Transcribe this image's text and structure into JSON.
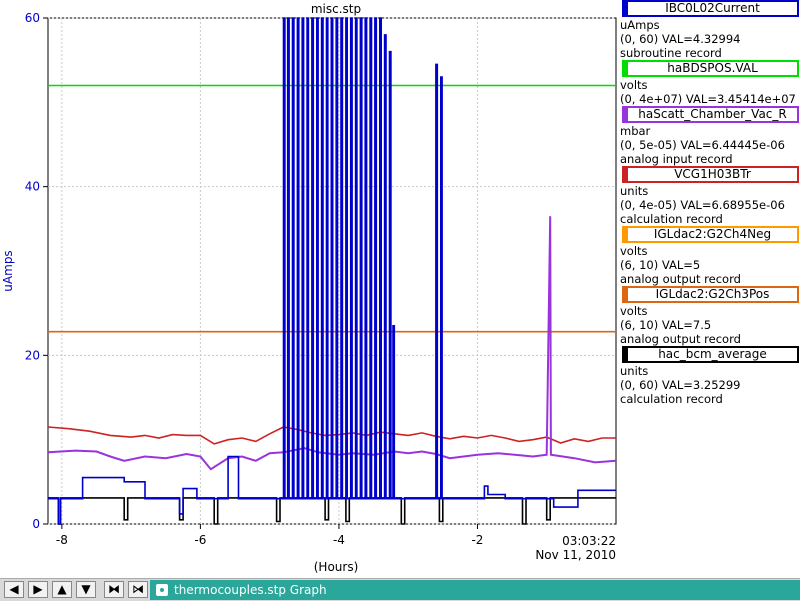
{
  "chart_data": {
    "type": "line",
    "title": "misc.stp",
    "xlabel": "(Hours)",
    "ylabel": "uAmps",
    "xlim": [
      -8.2,
      0
    ],
    "ylim": [
      0,
      60
    ],
    "x_ticks": [
      "-8",
      "-6",
      "-4",
      "-2"
    ],
    "x_tick_values": [
      -8,
      -6,
      -4,
      -2
    ],
    "y_ticks": [
      "0",
      "20",
      "40",
      "60"
    ],
    "y_tick_values": [
      0,
      20,
      40,
      60
    ],
    "end_time": "03:03:22",
    "end_date": "Nov 11, 2010",
    "grid": true,
    "legend_position": "right",
    "series": [
      {
        "name": "IBC0L02Current",
        "color": "#0000cc",
        "points": [
          [
            -8.2,
            3
          ],
          [
            -8.05,
            3
          ],
          [
            -8.05,
            0
          ],
          [
            -8.02,
            0
          ],
          [
            -8.02,
            3
          ],
          [
            -7.7,
            3
          ],
          [
            -7.7,
            5.5
          ],
          [
            -7.1,
            5.5
          ],
          [
            -7.1,
            5
          ],
          [
            -6.8,
            5
          ],
          [
            -6.8,
            3
          ],
          [
            -6.3,
            3
          ],
          [
            -6.3,
            1.2
          ],
          [
            -6.25,
            1.2
          ],
          [
            -6.25,
            4.2
          ],
          [
            -6.05,
            4.2
          ],
          [
            -6.05,
            3
          ],
          [
            -5.6,
            3
          ],
          [
            -5.6,
            8
          ],
          [
            -5.45,
            8
          ],
          [
            -5.45,
            3
          ],
          [
            -4.8,
            3
          ],
          [
            -4.8,
            60
          ],
          [
            -4.78,
            60
          ],
          [
            -4.78,
            3
          ],
          [
            -4.74,
            3
          ],
          [
            -4.74,
            60
          ],
          [
            -4.72,
            60
          ],
          [
            -4.72,
            3
          ],
          [
            -4.67,
            3
          ],
          [
            -4.67,
            60
          ],
          [
            -4.65,
            60
          ],
          [
            -4.65,
            3
          ],
          [
            -4.6,
            3
          ],
          [
            -4.6,
            60
          ],
          [
            -4.58,
            60
          ],
          [
            -4.58,
            3
          ],
          [
            -4.53,
            3
          ],
          [
            -4.53,
            60
          ],
          [
            -4.51,
            60
          ],
          [
            -4.51,
            3
          ],
          [
            -4.46,
            3
          ],
          [
            -4.46,
            60
          ],
          [
            -4.44,
            60
          ],
          [
            -4.44,
            3
          ],
          [
            -4.39,
            3
          ],
          [
            -4.39,
            60
          ],
          [
            -4.37,
            60
          ],
          [
            -4.37,
            3
          ],
          [
            -4.32,
            3
          ],
          [
            -4.32,
            60
          ],
          [
            -4.3,
            60
          ],
          [
            -4.3,
            3
          ],
          [
            -4.25,
            3
          ],
          [
            -4.25,
            60
          ],
          [
            -4.23,
            60
          ],
          [
            -4.23,
            3
          ],
          [
            -4.18,
            3
          ],
          [
            -4.18,
            60
          ],
          [
            -4.16,
            60
          ],
          [
            -4.16,
            3
          ],
          [
            -4.11,
            3
          ],
          [
            -4.11,
            60
          ],
          [
            -4.09,
            60
          ],
          [
            -4.09,
            3
          ],
          [
            -4.04,
            3
          ],
          [
            -4.04,
            60
          ],
          [
            -4.02,
            60
          ],
          [
            -4.02,
            3
          ],
          [
            -3.97,
            3
          ],
          [
            -3.97,
            60
          ],
          [
            -3.95,
            60
          ],
          [
            -3.95,
            3
          ],
          [
            -3.9,
            3
          ],
          [
            -3.9,
            60
          ],
          [
            -3.88,
            60
          ],
          [
            -3.88,
            3
          ],
          [
            -3.83,
            3
          ],
          [
            -3.83,
            60
          ],
          [
            -3.81,
            60
          ],
          [
            -3.81,
            3
          ],
          [
            -3.76,
            3
          ],
          [
            -3.76,
            60
          ],
          [
            -3.74,
            60
          ],
          [
            -3.74,
            3
          ],
          [
            -3.69,
            3
          ],
          [
            -3.69,
            60
          ],
          [
            -3.67,
            60
          ],
          [
            -3.67,
            3
          ],
          [
            -3.62,
            3
          ],
          [
            -3.62,
            60
          ],
          [
            -3.6,
            60
          ],
          [
            -3.6,
            3
          ],
          [
            -3.55,
            3
          ],
          [
            -3.55,
            60
          ],
          [
            -3.53,
            60
          ],
          [
            -3.53,
            3
          ],
          [
            -3.48,
            3
          ],
          [
            -3.48,
            60
          ],
          [
            -3.46,
            60
          ],
          [
            -3.46,
            3
          ],
          [
            -3.41,
            3
          ],
          [
            -3.41,
            60
          ],
          [
            -3.39,
            60
          ],
          [
            -3.39,
            3
          ],
          [
            -3.34,
            3
          ],
          [
            -3.34,
            58
          ],
          [
            -3.32,
            58
          ],
          [
            -3.32,
            3
          ],
          [
            -3.27,
            3
          ],
          [
            -3.27,
            56
          ],
          [
            -3.25,
            56
          ],
          [
            -3.25,
            3
          ],
          [
            -3.22,
            3
          ],
          [
            -3.22,
            23.5
          ],
          [
            -3.2,
            23.5
          ],
          [
            -3.2,
            3
          ],
          [
            -2.6,
            3
          ],
          [
            -2.6,
            54.5
          ],
          [
            -2.58,
            54.5
          ],
          [
            -2.58,
            3
          ],
          [
            -2.53,
            3
          ],
          [
            -2.53,
            53
          ],
          [
            -2.51,
            53
          ],
          [
            -2.51,
            3
          ],
          [
            -1.9,
            3
          ],
          [
            -1.9,
            4.5
          ],
          [
            -1.85,
            4.5
          ],
          [
            -1.85,
            3.5
          ],
          [
            -1.6,
            3.5
          ],
          [
            -1.6,
            3
          ],
          [
            -0.9,
            3
          ],
          [
            -0.9,
            2
          ],
          [
            -0.55,
            2
          ],
          [
            -0.55,
            4
          ],
          [
            0,
            4
          ]
        ]
      },
      {
        "name": "haBDSPOS.VAL",
        "color": "#00dd00",
        "points": [
          [
            -8.2,
            52
          ],
          [
            0,
            52
          ]
        ]
      },
      {
        "name": "haScatt_Chamber_Vac_R",
        "color": "#9933dd",
        "points": [
          [
            -8.2,
            8.5
          ],
          [
            -7.8,
            8.7
          ],
          [
            -7.5,
            8.6
          ],
          [
            -7.3,
            8
          ],
          [
            -7.1,
            7.5
          ],
          [
            -6.8,
            8
          ],
          [
            -6.5,
            7.8
          ],
          [
            -6.2,
            8.3
          ],
          [
            -6.0,
            8
          ],
          [
            -5.85,
            6.5
          ],
          [
            -5.6,
            7.8
          ],
          [
            -5.4,
            8
          ],
          [
            -5.2,
            7.5
          ],
          [
            -5.0,
            8.4
          ],
          [
            -4.8,
            8.5
          ],
          [
            -4.5,
            9
          ],
          [
            -4.3,
            8.5
          ],
          [
            -4.0,
            8.2
          ],
          [
            -3.8,
            8.4
          ],
          [
            -3.5,
            8.2
          ],
          [
            -3.2,
            8.6
          ],
          [
            -3.0,
            8.4
          ],
          [
            -2.8,
            8.6
          ],
          [
            -2.6,
            8.3
          ],
          [
            -2.4,
            7.8
          ],
          [
            -2.0,
            8.2
          ],
          [
            -1.7,
            8.4
          ],
          [
            -1.2,
            8
          ],
          [
            -1.0,
            8.2
          ],
          [
            -0.95,
            36.5
          ],
          [
            -0.94,
            8.2
          ],
          [
            -0.6,
            7.8
          ],
          [
            -0.3,
            7.3
          ],
          [
            0,
            7.5
          ]
        ]
      },
      {
        "name": "VCG1H03BTr",
        "color": "#cc2222",
        "points": [
          [
            -8.2,
            11.5
          ],
          [
            -7.9,
            11.3
          ],
          [
            -7.6,
            11
          ],
          [
            -7.3,
            10.5
          ],
          [
            -7.0,
            10.3
          ],
          [
            -6.8,
            10.5
          ],
          [
            -6.6,
            10.2
          ],
          [
            -6.4,
            10.6
          ],
          [
            -6.2,
            10.5
          ],
          [
            -6.0,
            10.5
          ],
          [
            -5.8,
            9.5
          ],
          [
            -5.6,
            10
          ],
          [
            -5.4,
            10.2
          ],
          [
            -5.2,
            9.8
          ],
          [
            -5.0,
            10.7
          ],
          [
            -4.8,
            11.5
          ],
          [
            -4.6,
            11.2
          ],
          [
            -4.4,
            10.8
          ],
          [
            -4.2,
            10.5
          ],
          [
            -4.0,
            10.6
          ],
          [
            -3.8,
            10.8
          ],
          [
            -3.6,
            10.5
          ],
          [
            -3.4,
            10.9
          ],
          [
            -3.2,
            10.7
          ],
          [
            -3.0,
            10.5
          ],
          [
            -2.8,
            10.8
          ],
          [
            -2.6,
            10.4
          ],
          [
            -2.4,
            10.1
          ],
          [
            -2.2,
            10.4
          ],
          [
            -2.0,
            10.2
          ],
          [
            -1.8,
            10.5
          ],
          [
            -1.6,
            10.2
          ],
          [
            -1.4,
            9.8
          ],
          [
            -1.2,
            10
          ],
          [
            -1.0,
            10.3
          ],
          [
            -0.8,
            9.6
          ],
          [
            -0.6,
            10.1
          ],
          [
            -0.4,
            9.8
          ],
          [
            -0.2,
            10.2
          ],
          [
            0,
            10.2
          ]
        ]
      },
      {
        "name": "IGLdac2:G2Ch4Neg",
        "color": "#ff9900",
        "points": []
      },
      {
        "name": "IGLdac2:G2Ch3Pos",
        "color": "#dd6611",
        "points": [
          [
            -8.2,
            22.8
          ],
          [
            0,
            22.8
          ]
        ]
      },
      {
        "name": "hac_bcm_average",
        "color": "#000000",
        "points": [
          [
            -8.2,
            3.1
          ],
          [
            -8.05,
            3.1
          ],
          [
            -8.05,
            0
          ],
          [
            -8.02,
            0
          ],
          [
            -8.02,
            3.1
          ],
          [
            -7.1,
            3.1
          ],
          [
            -7.1,
            0.5
          ],
          [
            -7.05,
            0.5
          ],
          [
            -7.05,
            3.1
          ],
          [
            -6.3,
            3.1
          ],
          [
            -6.3,
            0.5
          ],
          [
            -6.25,
            0.5
          ],
          [
            -6.25,
            3.1
          ],
          [
            -5.8,
            3.1
          ],
          [
            -5.8,
            0
          ],
          [
            -5.75,
            0
          ],
          [
            -5.75,
            3.1
          ],
          [
            -4.9,
            3.1
          ],
          [
            -4.9,
            0.3
          ],
          [
            -4.85,
            0.3
          ],
          [
            -4.85,
            3.1
          ],
          [
            -4.2,
            3.1
          ],
          [
            -4.2,
            0.5
          ],
          [
            -4.15,
            0.5
          ],
          [
            -4.15,
            3.1
          ],
          [
            -3.9,
            3.1
          ],
          [
            -3.9,
            0.3
          ],
          [
            -3.85,
            0.3
          ],
          [
            -3.85,
            3.1
          ],
          [
            -3.1,
            3.1
          ],
          [
            -3.1,
            0
          ],
          [
            -3.05,
            0
          ],
          [
            -3.05,
            3.1
          ],
          [
            -2.55,
            3.1
          ],
          [
            -2.55,
            0.3
          ],
          [
            -2.5,
            0.3
          ],
          [
            -2.5,
            3.1
          ],
          [
            -1.35,
            3.1
          ],
          [
            -1.35,
            0
          ],
          [
            -1.3,
            0
          ],
          [
            -1.3,
            3.1
          ],
          [
            -1.0,
            3.1
          ],
          [
            -1.0,
            0.5
          ],
          [
            -0.95,
            0.5
          ],
          [
            -0.95,
            3.1
          ],
          [
            0,
            3.1
          ]
        ]
      }
    ]
  },
  "legend": [
    {
      "name": "IBC0L02Current",
      "color": "#0000cc",
      "unit": "uAmps",
      "range": "(0, 60) VAL=4.32994",
      "type": "subroutine record"
    },
    {
      "name": "haBDSPOS.VAL",
      "color": "#00dd00",
      "unit": "volts",
      "range": "(0, 4e+07) VAL=3.45414e+07",
      "type": ""
    },
    {
      "name": "haScatt_Chamber_Vac_R",
      "color": "#9933dd",
      "unit": "mbar",
      "range": "(0, 5e-05) VAL=6.44445e-06",
      "type": "analog input record"
    },
    {
      "name": "VCG1H03BTr",
      "color": "#cc2222",
      "unit": "units",
      "range": "(0, 4e-05) VAL=6.68955e-06",
      "type": "calculation record"
    },
    {
      "name": "IGLdac2:G2Ch4Neg",
      "color": "#ff9900",
      "unit": "volts",
      "range": "(6, 10) VAL=5",
      "type": "analog output record"
    },
    {
      "name": "IGLdac2:G2Ch3Pos",
      "color": "#dd6611",
      "unit": "volts",
      "range": "(6, 10) VAL=7.5",
      "type": "analog output record"
    },
    {
      "name": "hac_bcm_average",
      "color": "#000000",
      "unit": "units",
      "range": "(0, 60) VAL=3.25299",
      "type": "calculation record"
    }
  ],
  "taskbar": {
    "buttons": [
      {
        "name": "left-arrow-icon",
        "glyph": "◀"
      },
      {
        "name": "right-arrow-icon",
        "glyph": "▶"
      },
      {
        "name": "up-arrow-icon",
        "glyph": "▲"
      },
      {
        "name": "down-arrow-icon",
        "glyph": "▼"
      },
      {
        "name": "collapse-icon",
        "glyph": "⧓"
      },
      {
        "name": "expand-icon",
        "glyph": "⧒"
      }
    ],
    "window_title": "thermocouples.stp Graph"
  }
}
